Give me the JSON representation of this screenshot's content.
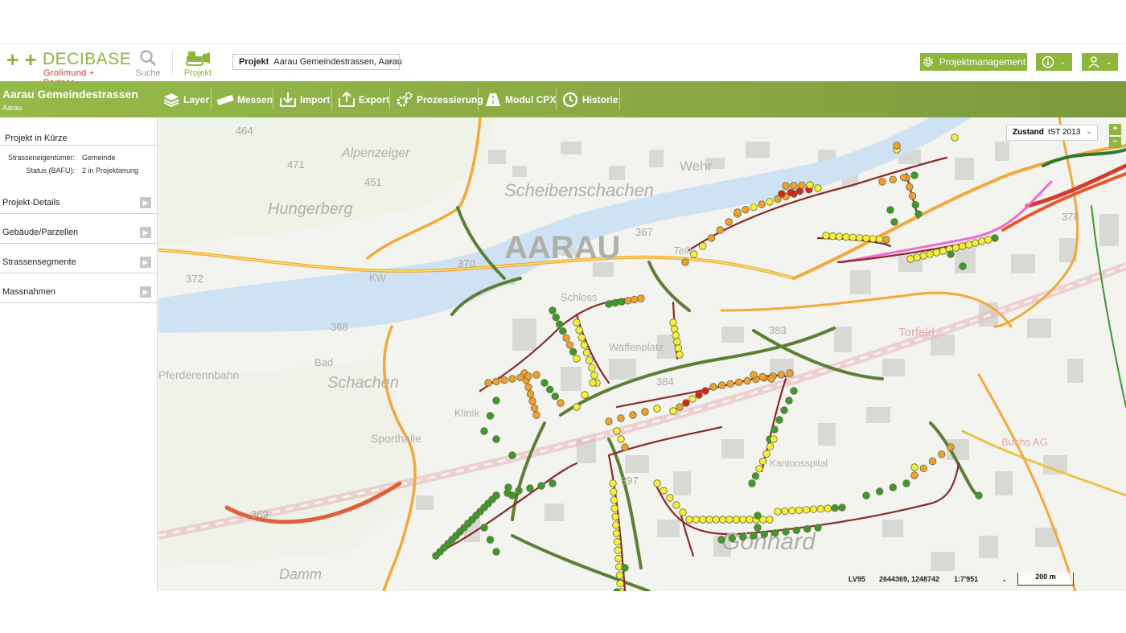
{
  "brand": {
    "name": "DECIBASE",
    "plus": "+ +",
    "company": "Grolimund + Partner"
  },
  "topnav": {
    "search_label": "Suche",
    "project_label": "Projekt"
  },
  "project_select": {
    "label": "Projekt",
    "value": "Aarau Gemeindestrassen, Aarau"
  },
  "header_buttons": {
    "management": "Projektmanagement"
  },
  "project": {
    "title": "Aarau Gemeindestrassen",
    "location": "Aarau"
  },
  "toolbar": [
    {
      "label": "Layer",
      "icon": "layers-icon"
    },
    {
      "label": "Messen",
      "icon": "ruler-icon"
    },
    {
      "label": "Import",
      "icon": "import-icon"
    },
    {
      "label": "Export",
      "icon": "export-icon"
    },
    {
      "label": "Prozessierung",
      "icon": "gears-icon"
    },
    {
      "label": "Modul CPX",
      "icon": "road-icon"
    },
    {
      "label": "Historie",
      "icon": "history-icon"
    }
  ],
  "sidebar": {
    "summary_title": "Projekt in Kürze",
    "fields": [
      {
        "key": "Strasseneigentümer:",
        "value": "Gemeinde"
      },
      {
        "key": "Status (BAFU):",
        "value": "2 in Projektierung"
      }
    ],
    "sections": [
      "Projekt-Details",
      "Gebäude/Parzellen",
      "Strassensegmente",
      "Massnahmen"
    ]
  },
  "map": {
    "state_label": "Zustand",
    "state_value": "IST 2013",
    "zoom_in": "+",
    "zoom_out": "−",
    "crs": "LV95",
    "coords": "2644369, 1248742",
    "scale": "1:7'951",
    "scalebar": "200 m",
    "place_labels": [
      "AARAU",
      "Scheibenschachen",
      "Hungerberg",
      "Alpenzeiger",
      "Wehr",
      "Schachen",
      "Pferderennbahn",
      "Sporthalle",
      "Gönhard",
      "Torfeld",
      "Waffenplatz",
      "Schloss",
      "Kantonsspital",
      "Buchs AG",
      "Klinik",
      "KW",
      "Bad",
      "Damm",
      "Telli"
    ],
    "elevations": [
      "464",
      "471",
      "451",
      "372",
      "370",
      "368",
      "367",
      "384",
      "383",
      "378",
      "397",
      "369"
    ],
    "colors": {
      "good": "#3b9a2e",
      "ok": "#f4f03a",
      "medium": "#f0a030",
      "bad": "#e0201a",
      "segment": "#8b2a2a"
    }
  }
}
